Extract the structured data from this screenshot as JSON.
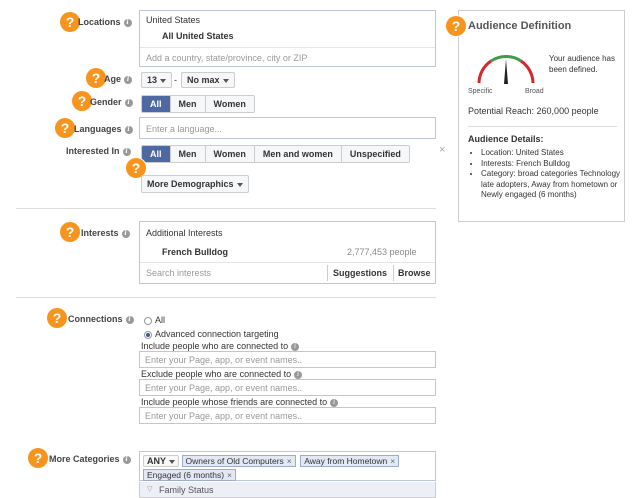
{
  "form": {
    "locations": {
      "label": "Locations",
      "country": "United States",
      "selected": "All United States",
      "placeholder": "Add a country, state/province, city or ZIP"
    },
    "age": {
      "label": "Age",
      "min": "13",
      "max": "No max",
      "separator": "-"
    },
    "gender": {
      "label": "Gender",
      "options": [
        "All",
        "Men",
        "Women"
      ],
      "selected": "All"
    },
    "languages": {
      "label": "Languages",
      "placeholder": "Enter a language..."
    },
    "interested_in": {
      "label": "Interested In",
      "options": [
        "All",
        "Men",
        "Women",
        "Men and women",
        "Unspecified"
      ],
      "selected": "All",
      "clear": "×"
    },
    "more_demographics": "More Demographics",
    "interests": {
      "label": "Interests",
      "header": "Additional Interests",
      "item_name": "French Bulldog",
      "item_count": "2,777,453 people",
      "search_placeholder": "Search interests",
      "suggestions": "Suggestions",
      "browse": "Browse"
    },
    "connections": {
      "label": "Connections",
      "option_all": "All",
      "option_advanced": "Advanced connection targeting",
      "include_label": "Include people who are connected to",
      "include_placeholder": "Enter your Page, app, or event names..",
      "exclude_label": "Exclude people who are connected to",
      "exclude_placeholder": "Enter your Page, app, or event names..",
      "friends_label": "Include people whose friends are connected to",
      "friends_placeholder": "Enter your Page, app, or event names.."
    },
    "more_categories": {
      "label": "More Categories",
      "any": "ANY",
      "tags": [
        "Owners of Old Computers",
        "Away from Hometown",
        "Engaged (6 months)"
      ],
      "tag_remove": "×",
      "subgroup": "Family Status"
    }
  },
  "help_marker": "?",
  "info_marker": "i",
  "audience": {
    "title": "Audience Definition",
    "status": "Your audience has been defined.",
    "gauge_left": "Specific",
    "gauge_right": "Broad",
    "reach": "Potential Reach: 260,000 people",
    "details_title": "Audience Details:",
    "details": [
      "Location: United States",
      "Interests: French Bulldog",
      "Category: broad categories Technology late adopters, Away from hometown or Newly engaged (6 months)"
    ]
  },
  "colors": {
    "help_marker": "#f7941d",
    "selected_button": "#4e69a2",
    "tag_bg": "#e2e8f4"
  }
}
